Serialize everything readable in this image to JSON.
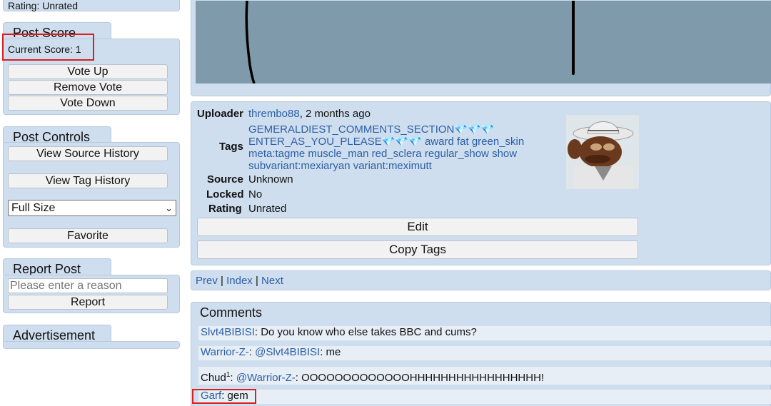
{
  "sidebar": {
    "rating_top": "Rating: Unrated",
    "post_score": {
      "title": "Post Score",
      "current_score": "Current Score: 1",
      "vote_up": "Vote Up",
      "remove_vote": "Remove Vote",
      "vote_down": "Vote Down"
    },
    "post_controls": {
      "title": "Post Controls",
      "view_source_history": "View Source History",
      "view_tag_history": "View Tag History",
      "size_select": "Full Size",
      "favorite": "Favorite"
    },
    "report_post": {
      "title": "Report Post",
      "reason_placeholder": "Please enter a reason",
      "report": "Report"
    },
    "advertisement": {
      "title": "Advertisement"
    }
  },
  "info": {
    "uploader_label": "Uploader",
    "uploader_name": "thrembo88",
    "uploader_time": ", 2 months ago",
    "tags_label": "Tags",
    "tags": [
      "GEMERALDIEST_COMMENTS_SECTION💎💎💎",
      "ENTER_AS_YOU_PLEASE💎💎💎",
      "award",
      "fat",
      "green_skin",
      "meta:tagme",
      "muscle_man",
      "red_sclera",
      "regular_show",
      "show",
      "subvariant:mexiaryan",
      "variant:meximutt"
    ],
    "source_label": "Source",
    "source_value": "Unknown",
    "locked_label": "Locked",
    "locked_value": "No",
    "rating_label": "Rating",
    "rating_value": "Unrated",
    "edit_button": "Edit",
    "copy_tags_button": "Copy Tags"
  },
  "nav": {
    "prev": "Prev",
    "sep1": "|",
    "index": "Index",
    "sep2": "|",
    "next": "Next"
  },
  "comments": {
    "title": "Comments",
    "items": [
      {
        "author": "Slvt4BIBISI",
        "mention": "",
        "text": ": Do you know who else takes BBC and cums?"
      },
      {
        "author": "Warrior-Z-",
        "mention": "@Slvt4BIBISI",
        "text": ": me"
      },
      {
        "author": "Chud",
        "sup": "1",
        "mention": "@Warrior-Z-",
        "text": ": OOOOOOOOOOOOOHHHHHHHHHHHHHHHHH!"
      },
      {
        "author": "Garf",
        "mention": "",
        "text": ": gem"
      }
    ]
  },
  "colors": {
    "panel": "#cfdeee",
    "panel_border": "#b7c9dd",
    "link": "#2a5fa6",
    "highlight": "#d82020",
    "image_bg": "#7f9aab"
  }
}
